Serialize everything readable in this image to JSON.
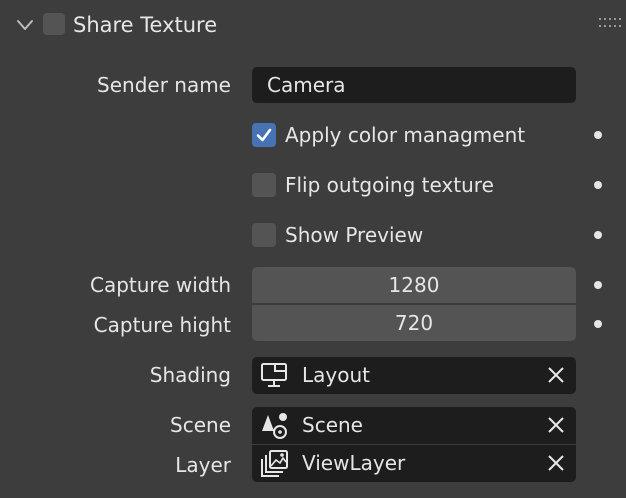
{
  "panel": {
    "title": "Share Texture",
    "enabled": false
  },
  "fields": {
    "sender_name": {
      "label": "Sender name",
      "value": "Camera"
    },
    "apply_color": {
      "label": "Apply color managment",
      "checked": true
    },
    "flip_texture": {
      "label": "Flip outgoing texture",
      "checked": false
    },
    "show_preview": {
      "label": "Show Preview",
      "checked": false
    },
    "capture_width": {
      "label": "Capture width",
      "value": "1280"
    },
    "capture_height": {
      "label": "Capture hight",
      "value": "720"
    },
    "shading": {
      "label": "Shading",
      "value": "Layout",
      "icon": "screen-icon"
    },
    "scene": {
      "label": "Scene",
      "value": "Scene",
      "icon": "scene-icon"
    },
    "layer": {
      "label": "Layer",
      "value": "ViewLayer",
      "icon": "render-layers-icon"
    }
  },
  "colors": {
    "background": "#3d3d3d",
    "field_dark": "#1d1d1d",
    "field_light": "#545454",
    "accent": "#4772b3",
    "text": "#e6e6e6"
  }
}
